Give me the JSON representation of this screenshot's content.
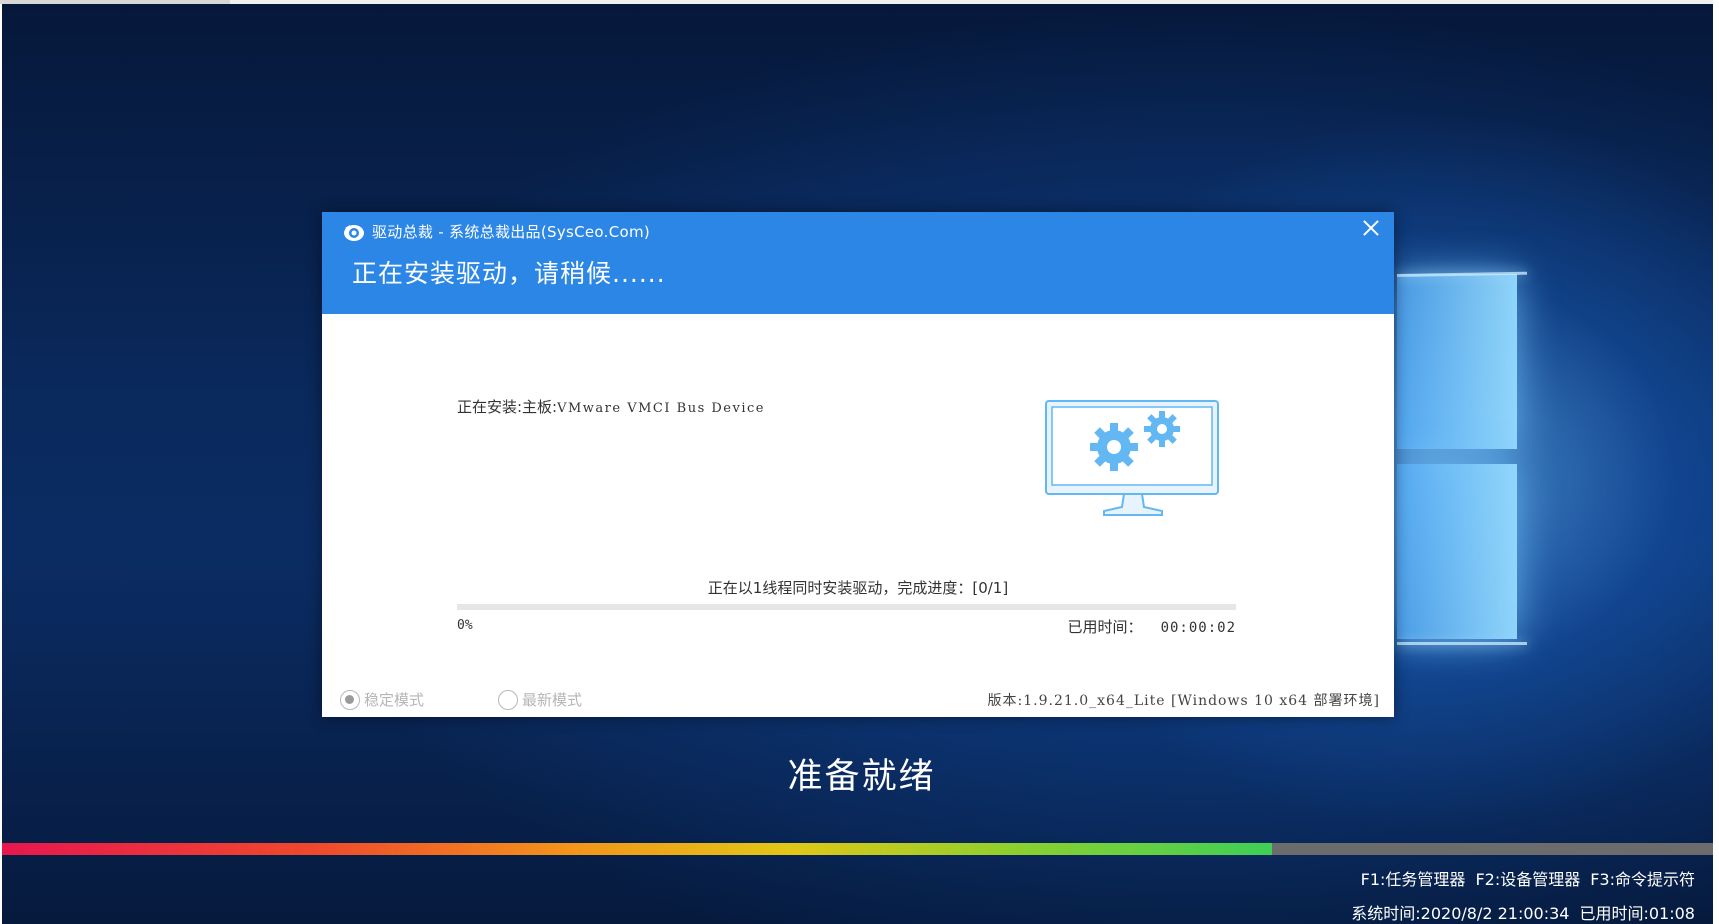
{
  "dialog": {
    "title": "驱动总裁 - 系统总裁出品(SysCeo.Com)",
    "heading": "正在安装驱动，请稍候......",
    "installing_label": "正在安装:主板:",
    "installing_device": "VMware VMCI Bus Device",
    "progress_status": "正在以1线程同时安装驱动，完成进度：[0/1]",
    "progress_percent": "0%",
    "progress_fraction": 0,
    "elapsed_label": "已用时间：",
    "elapsed_value": "00:00:02",
    "mode_stable": "稳定模式",
    "mode_latest": "最新模式",
    "mode_selected": "稳定模式",
    "version": "版本:1.9.21.0_x64_Lite [Windows 10 x64 部署环境]"
  },
  "desktop": {
    "ready_text": "准备就绪",
    "load_progress": 0.74,
    "hotkeys": [
      "F1:任务管理器",
      "F2:设备管理器",
      "F3:命令提示符"
    ],
    "system_time": "系统时间:2020/8/2 21:00:34",
    "elapsed_time": "已用时间:01:08"
  },
  "colors": {
    "header_blue": "#2b86e6",
    "background_navy": "#0a2a5e",
    "icon_light_blue": "#63b7f2"
  },
  "icons": {
    "app_logo": "app-logo-icon",
    "close": "close-icon",
    "monitor_gears": "monitor-gears-icon"
  }
}
